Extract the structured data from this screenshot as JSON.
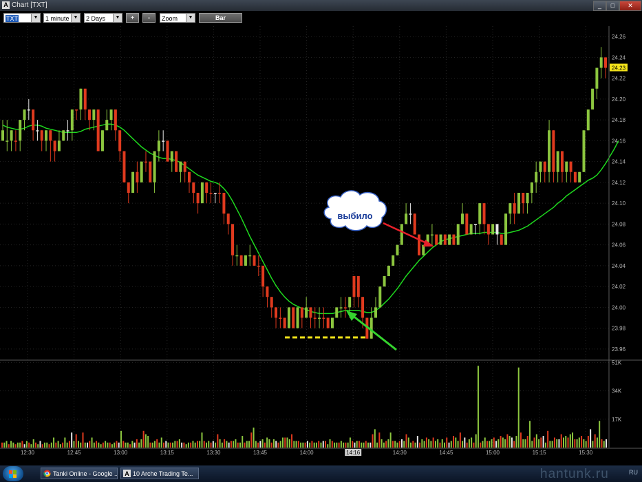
{
  "window": {
    "title": "Chart [TXT]",
    "app_icon_glyph": "A",
    "controls": {
      "minimize": "_",
      "maximize": "□",
      "close": "✕"
    }
  },
  "toolbar": {
    "symbol": "TXT",
    "interval": "1 minute",
    "range": "2 Days",
    "zoom_in_label": "+",
    "zoom_out_label": "-",
    "zoom": "Zoom",
    "chart_type_label": "Bar"
  },
  "annotation": {
    "bubble_text": "выбило",
    "colors": {
      "arrow_red": "#e8202a",
      "arrow_green": "#35d42e",
      "support_line": "#f2e21a"
    }
  },
  "chart_data": {
    "type": "bar",
    "price_axis_ticks": [
      "24.26",
      "24.24",
      "24.22",
      "24.20",
      "24.18",
      "24.16",
      "24.14",
      "24.12",
      "24.10",
      "24.08",
      "24.06",
      "24.04",
      "24.02",
      "24.00",
      "23.98",
      "23.96"
    ],
    "current_price": "24.23",
    "volume_axis_ticks": [
      "51K",
      "34K",
      "17K"
    ],
    "time_ticks": [
      "12:30",
      "12:45",
      "13:00",
      "13:15",
      "13:30",
      "13:45",
      "14:00",
      "14:16",
      "14:30",
      "14:45",
      "15:00",
      "15:15",
      "15:30"
    ],
    "ylim": [
      23.95,
      24.27
    ],
    "volume_ylim": [
      0,
      52000
    ],
    "colors": {
      "up": "#8cc63f",
      "down": "#e03a1e",
      "ma": "#1ed81e",
      "grid": "#262626",
      "axis_text": "#b8b8b8",
      "neutral": "#e8e8e8"
    },
    "candles": [
      [
        24.17,
        24.16,
        24.18,
        24.16,
        1
      ],
      [
        24.16,
        24.16,
        24.18,
        24.15,
        1
      ],
      [
        24.16,
        24.17,
        24.17,
        24.15,
        1
      ],
      [
        24.16,
        24.16,
        24.17,
        24.15,
        -1
      ],
      [
        24.16,
        24.18,
        24.18,
        24.15,
        1
      ],
      [
        24.18,
        24.19,
        24.19,
        24.17,
        1
      ],
      [
        24.19,
        24.19,
        24.2,
        24.18,
        0
      ],
      [
        24.19,
        24.17,
        24.19,
        24.16,
        -1
      ],
      [
        24.17,
        24.17,
        24.18,
        24.16,
        0
      ],
      [
        24.17,
        24.16,
        24.17,
        24.15,
        -1
      ],
      [
        24.16,
        24.17,
        24.17,
        24.15,
        1
      ],
      [
        24.17,
        24.16,
        24.17,
        24.14,
        -1
      ],
      [
        24.16,
        24.15,
        24.16,
        24.14,
        -1
      ],
      [
        24.15,
        24.16,
        24.17,
        24.15,
        1
      ],
      [
        24.16,
        24.17,
        24.17,
        24.16,
        1
      ],
      [
        24.17,
        24.17,
        24.18,
        24.16,
        0
      ],
      [
        24.17,
        24.19,
        24.19,
        24.16,
        1
      ],
      [
        24.19,
        24.19,
        24.19,
        24.18,
        -1
      ],
      [
        24.19,
        24.21,
        24.21,
        24.18,
        1
      ],
      [
        24.21,
        24.19,
        24.21,
        24.18,
        -1
      ],
      [
        24.19,
        24.18,
        24.19,
        24.17,
        -1
      ],
      [
        24.18,
        24.19,
        24.19,
        24.17,
        1
      ],
      [
        24.19,
        24.15,
        24.19,
        24.15,
        -1
      ],
      [
        24.15,
        24.17,
        24.17,
        24.15,
        1
      ],
      [
        24.17,
        24.18,
        24.19,
        24.17,
        1
      ],
      [
        24.18,
        24.19,
        24.19,
        24.17,
        1
      ],
      [
        24.19,
        24.17,
        24.19,
        24.16,
        -1
      ],
      [
        24.17,
        24.15,
        24.17,
        24.14,
        -1
      ],
      [
        24.15,
        24.12,
        24.15,
        24.12,
        -1
      ],
      [
        24.12,
        24.11,
        24.12,
        24.1,
        -1
      ],
      [
        24.11,
        24.13,
        24.13,
        24.11,
        1
      ],
      [
        24.13,
        24.12,
        24.14,
        24.11,
        -1
      ],
      [
        24.12,
        24.14,
        24.14,
        24.12,
        1
      ],
      [
        24.14,
        24.14,
        24.15,
        24.13,
        -1
      ],
      [
        24.14,
        24.12,
        24.14,
        24.12,
        -1
      ],
      [
        24.12,
        24.15,
        24.15,
        24.11,
        1
      ],
      [
        24.15,
        24.16,
        24.17,
        24.14,
        1
      ],
      [
        24.16,
        24.16,
        24.17,
        24.15,
        0
      ],
      [
        24.16,
        24.14,
        24.16,
        24.14,
        -1
      ],
      [
        24.14,
        24.15,
        24.15,
        24.13,
        1
      ],
      [
        24.15,
        24.13,
        24.15,
        24.13,
        -1
      ],
      [
        24.13,
        24.14,
        24.14,
        24.12,
        1
      ],
      [
        24.14,
        24.13,
        24.14,
        24.12,
        -1
      ],
      [
        24.13,
        24.12,
        24.13,
        24.11,
        -1
      ],
      [
        24.12,
        24.11,
        24.12,
        24.1,
        -1
      ],
      [
        24.11,
        24.1,
        24.11,
        24.09,
        -1
      ],
      [
        24.1,
        24.12,
        24.12,
        24.1,
        1
      ],
      [
        24.12,
        24.11,
        24.12,
        24.1,
        -1
      ],
      [
        24.11,
        24.11,
        24.12,
        24.1,
        -1
      ],
      [
        24.11,
        24.11,
        24.11,
        24.1,
        0
      ],
      [
        24.11,
        24.11,
        24.12,
        24.1,
        -1
      ],
      [
        24.11,
        24.09,
        24.11,
        24.08,
        -1
      ],
      [
        24.09,
        24.08,
        24.09,
        24.07,
        -1
      ],
      [
        24.08,
        24.05,
        24.08,
        24.04,
        -1
      ],
      [
        24.05,
        24.05,
        24.06,
        24.04,
        1
      ],
      [
        24.05,
        24.04,
        24.05,
        24.04,
        -1
      ],
      [
        24.04,
        24.05,
        24.05,
        24.04,
        1
      ],
      [
        24.05,
        24.05,
        24.06,
        24.04,
        1
      ],
      [
        24.05,
        24.04,
        24.05,
        24.04,
        -1
      ],
      [
        24.04,
        24.04,
        24.05,
        24.03,
        -1
      ],
      [
        24.04,
        24.02,
        24.04,
        24.01,
        -1
      ],
      [
        24.02,
        24.01,
        24.02,
        24.0,
        -1
      ],
      [
        24.01,
        24.0,
        24.01,
        23.99,
        -1
      ],
      [
        24.0,
        23.99,
        24.0,
        23.98,
        -1
      ],
      [
        23.99,
        23.99,
        24.0,
        23.98,
        -1
      ],
      [
        23.99,
        23.98,
        23.99,
        23.98,
        -1
      ],
      [
        23.98,
        24.0,
        24.0,
        23.98,
        1
      ],
      [
        24.0,
        23.98,
        24.0,
        23.98,
        -1
      ],
      [
        23.98,
        24.0,
        24.0,
        23.98,
        1
      ],
      [
        24.0,
        23.99,
        24.0,
        23.98,
        -1
      ],
      [
        23.99,
        24.0,
        24.01,
        23.99,
        1
      ],
      [
        24.0,
        23.99,
        24.0,
        23.98,
        -1
      ],
      [
        23.99,
        23.99,
        24.0,
        23.98,
        -1
      ],
      [
        23.99,
        23.99,
        24.0,
        23.98,
        1
      ],
      [
        23.99,
        23.99,
        24.0,
        23.98,
        -1
      ],
      [
        23.99,
        23.98,
        23.99,
        23.98,
        -1
      ],
      [
        23.98,
        23.99,
        23.99,
        23.98,
        1
      ],
      [
        23.99,
        24.0,
        24.0,
        23.99,
        1
      ],
      [
        24.0,
        24.0,
        24.01,
        23.99,
        1
      ],
      [
        24.0,
        24.0,
        24.01,
        23.99,
        -1
      ],
      [
        24.0,
        24.01,
        24.01,
        23.99,
        1
      ],
      [
        24.01,
        24.03,
        24.03,
        24.0,
        -1
      ],
      [
        24.03,
        24.01,
        24.03,
        24.0,
        -1
      ],
      [
        24.01,
        23.99,
        24.01,
        23.98,
        -1
      ],
      [
        23.99,
        23.97,
        23.99,
        23.97,
        -1
      ],
      [
        23.97,
        23.99,
        24.0,
        23.97,
        1
      ],
      [
        23.99,
        24.0,
        24.01,
        23.99,
        1
      ],
      [
        24.0,
        24.02,
        24.02,
        24.0,
        1
      ],
      [
        24.02,
        24.03,
        24.03,
        24.02,
        1
      ],
      [
        24.03,
        24.04,
        24.04,
        24.03,
        1
      ],
      [
        24.04,
        24.05,
        24.05,
        24.04,
        1
      ],
      [
        24.05,
        24.06,
        24.06,
        24.05,
        1
      ],
      [
        24.06,
        24.08,
        24.08,
        24.06,
        1
      ],
      [
        24.08,
        24.09,
        24.1,
        24.08,
        1
      ],
      [
        24.09,
        24.09,
        24.1,
        24.08,
        0
      ],
      [
        24.09,
        24.07,
        24.09,
        24.07,
        -1
      ],
      [
        24.07,
        24.05,
        24.07,
        24.05,
        -1
      ],
      [
        24.05,
        24.06,
        24.06,
        24.05,
        1
      ],
      [
        24.06,
        24.07,
        24.07,
        24.06,
        1
      ],
      [
        24.07,
        24.07,
        24.08,
        24.06,
        1
      ],
      [
        24.07,
        24.06,
        24.07,
        24.06,
        -1
      ],
      [
        24.06,
        24.07,
        24.07,
        24.06,
        1
      ],
      [
        24.07,
        24.06,
        24.07,
        24.06,
        -1
      ],
      [
        24.06,
        24.07,
        24.07,
        24.06,
        1
      ],
      [
        24.07,
        24.06,
        24.07,
        24.06,
        -1
      ],
      [
        24.06,
        24.08,
        24.08,
        24.06,
        1
      ],
      [
        24.08,
        24.09,
        24.1,
        24.08,
        1
      ],
      [
        24.09,
        24.07,
        24.09,
        24.07,
        -1
      ],
      [
        24.07,
        24.08,
        24.08,
        24.07,
        1
      ],
      [
        24.08,
        24.08,
        24.08,
        24.07,
        0
      ],
      [
        24.08,
        24.1,
        24.1,
        24.07,
        1
      ],
      [
        24.1,
        24.08,
        24.1,
        24.07,
        -1
      ],
      [
        24.08,
        24.07,
        24.08,
        24.06,
        -1
      ],
      [
        24.07,
        24.08,
        24.08,
        24.07,
        1
      ],
      [
        24.08,
        24.07,
        24.08,
        24.06,
        0
      ],
      [
        24.07,
        24.06,
        24.07,
        24.06,
        -1
      ],
      [
        24.06,
        24.09,
        24.09,
        24.06,
        1
      ],
      [
        24.09,
        24.1,
        24.1,
        24.08,
        1
      ],
      [
        24.1,
        24.09,
        24.11,
        24.08,
        -1
      ],
      [
        24.09,
        24.11,
        24.11,
        24.09,
        1
      ],
      [
        24.11,
        24.1,
        24.11,
        24.09,
        -1
      ],
      [
        24.1,
        24.11,
        24.11,
        24.09,
        1
      ],
      [
        24.11,
        24.12,
        24.12,
        24.1,
        1
      ],
      [
        24.12,
        24.13,
        24.14,
        24.11,
        1
      ],
      [
        24.13,
        24.14,
        24.14,
        24.12,
        1
      ],
      [
        24.14,
        24.13,
        24.14,
        24.12,
        -1
      ],
      [
        24.13,
        24.17,
        24.18,
        24.12,
        1
      ],
      [
        24.17,
        24.13,
        24.17,
        24.12,
        -1
      ],
      [
        24.13,
        24.15,
        24.15,
        24.12,
        1
      ],
      [
        24.15,
        24.13,
        24.15,
        24.12,
        -1
      ],
      [
        24.13,
        24.14,
        24.14,
        24.12,
        1
      ],
      [
        24.14,
        24.13,
        24.14,
        24.12,
        -1
      ],
      [
        24.13,
        24.12,
        24.13,
        24.12,
        -1
      ],
      [
        24.12,
        24.13,
        24.13,
        24.12,
        1
      ],
      [
        24.13,
        24.17,
        24.17,
        24.13,
        1
      ],
      [
        24.17,
        24.19,
        24.19,
        24.17,
        1
      ],
      [
        24.19,
        24.21,
        24.21,
        24.19,
        1
      ],
      [
        24.21,
        24.23,
        24.23,
        24.2,
        1
      ],
      [
        24.23,
        24.24,
        24.25,
        24.22,
        1
      ],
      [
        24.24,
        24.23,
        24.24,
        24.22,
        -1
      ]
    ],
    "ma": [
      24.175,
      24.173,
      24.172,
      24.171,
      24.171,
      24.172,
      24.174,
      24.175,
      24.175,
      24.174,
      24.172,
      24.171,
      24.17,
      24.169,
      24.168,
      24.168,
      24.168,
      24.168,
      24.169,
      24.171,
      24.172,
      24.173,
      24.174,
      24.175,
      24.176,
      24.176,
      24.175,
      24.173,
      24.17,
      24.166,
      24.162,
      24.158,
      24.154,
      24.151,
      24.148,
      24.146,
      24.144,
      24.143,
      24.143,
      24.142,
      24.141,
      24.139,
      24.136,
      24.133,
      24.13,
      24.127,
      24.125,
      24.123,
      24.121,
      24.12,
      24.118,
      24.114,
      24.109,
      24.102,
      24.094,
      24.086,
      24.077,
      24.068,
      24.06,
      24.052,
      24.044,
      24.036,
      24.028,
      24.021,
      24.015,
      24.01,
      24.006,
      24.003,
      24.001,
      23.999,
      23.998,
      23.996,
      23.995,
      23.994,
      23.994,
      23.994,
      23.994,
      23.995,
      23.996,
      23.997,
      23.997,
      23.997,
      23.997,
      23.996,
      23.995,
      23.995,
      23.997,
      24.0,
      24.004,
      24.008,
      24.013,
      24.018,
      24.024,
      24.03,
      24.035,
      24.04,
      24.045,
      24.049,
      24.053,
      24.057,
      24.06,
      24.063,
      24.065,
      24.066,
      24.067,
      24.068,
      24.069,
      24.07,
      24.071,
      24.071,
      24.071,
      24.072,
      24.072,
      24.072,
      24.072,
      24.071,
      24.071,
      24.072,
      24.073,
      24.074,
      24.076,
      24.078,
      24.081,
      24.084,
      24.087,
      24.09,
      24.093,
      24.096,
      24.1,
      24.103,
      24.107,
      24.11,
      24.113,
      24.116,
      24.119,
      24.122,
      24.124,
      24.127,
      24.132,
      24.138,
      24.145,
      24.152,
      24.16
    ],
    "volume": [
      3,
      3,
      4,
      2,
      4,
      3,
      2,
      3,
      3,
      4,
      2,
      4,
      3,
      2,
      5,
      3,
      2,
      4,
      2,
      3,
      3,
      2,
      3,
      6,
      3,
      4,
      2,
      3,
      6,
      3,
      4,
      9,
      4,
      8,
      4,
      3,
      9,
      3,
      3,
      4,
      6,
      3,
      4,
      3,
      2,
      3,
      4,
      3,
      3,
      2,
      3,
      4,
      3,
      10,
      4,
      3,
      3,
      2,
      4,
      3,
      5,
      3,
      5,
      10,
      8,
      7,
      3,
      3,
      4,
      5,
      3,
      6,
      3,
      4,
      3,
      3,
      3,
      4,
      4,
      5,
      3,
      3,
      2,
      3,
      3,
      4,
      3,
      4,
      4,
      9,
      4,
      3,
      4,
      3,
      4,
      3,
      8,
      5,
      3,
      5,
      4,
      3,
      4,
      4,
      5,
      3,
      3,
      7,
      3,
      4,
      4,
      9,
      12,
      4,
      3,
      4,
      5,
      3,
      6,
      5,
      3,
      5,
      4,
      3,
      4,
      6,
      6,
      6,
      5,
      8,
      4,
      4,
      4,
      3,
      3,
      3,
      4,
      3,
      4,
      3,
      3,
      4,
      3,
      4,
      4,
      2,
      5,
      4,
      3,
      3,
      3,
      4,
      3,
      3,
      3,
      6,
      4,
      3,
      4,
      4,
      3,
      3,
      4,
      3,
      3,
      8,
      11,
      3,
      9,
      5,
      3,
      4,
      5,
      9,
      4,
      4,
      3,
      4,
      5,
      4,
      8,
      6,
      3,
      4,
      3,
      7,
      3,
      5,
      4,
      6,
      5,
      4,
      6,
      4,
      5,
      3,
      5,
      3,
      6,
      3,
      4,
      7,
      6,
      4,
      9,
      4,
      6,
      3,
      5,
      6,
      3,
      8,
      49,
      3,
      4,
      6,
      4,
      4,
      5,
      6,
      4,
      5,
      7,
      6,
      5,
      8,
      7,
      6,
      4,
      7,
      48,
      9,
      5,
      5,
      7,
      16,
      4,
      6,
      8,
      5,
      6,
      7,
      3,
      10,
      4,
      4,
      6,
      5,
      5,
      8,
      6,
      7,
      6,
      8,
      9,
      5,
      5,
      6,
      7,
      5,
      4,
      7,
      11,
      4,
      8,
      6,
      16,
      5,
      4,
      5
    ]
  },
  "taskbar": {
    "items": [
      {
        "label": "Tanki Online - Google ...",
        "icon": "chrome-icon"
      },
      {
        "label": "10 Arche Trading Te...",
        "icon": "arche-icon"
      }
    ],
    "watermark": "hantunk.ru",
    "tray_lang": "RU"
  }
}
